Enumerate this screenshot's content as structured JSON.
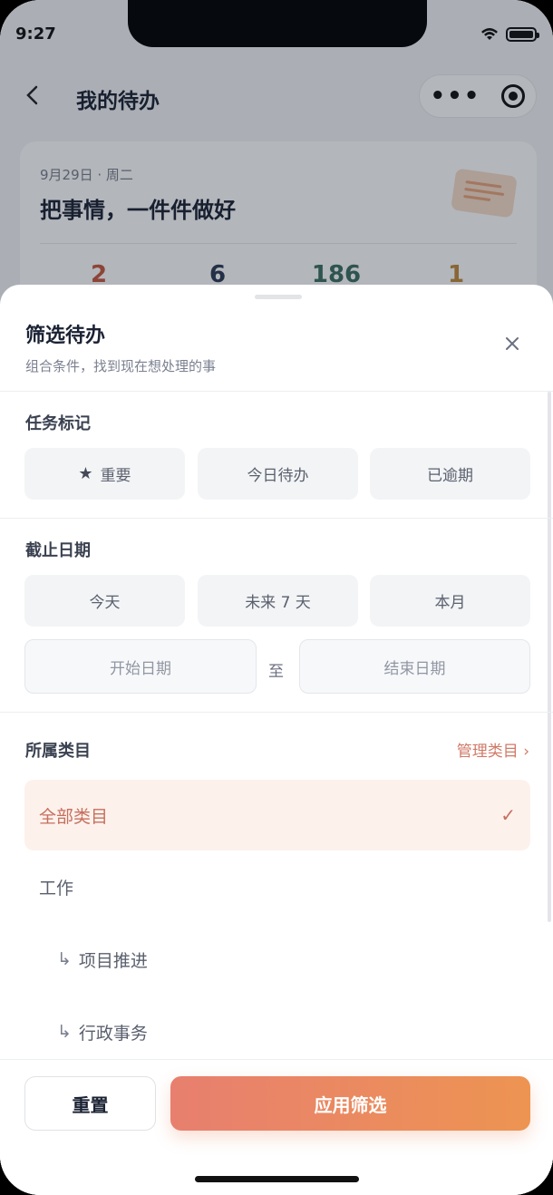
{
  "status": {
    "time": "9:27"
  },
  "nav": {
    "title": "我的待办"
  },
  "card": {
    "date": "9月29日 · 周二",
    "title": "把事情，一件件做好",
    "stats": [
      {
        "value": "2",
        "color": "#c8573f"
      },
      {
        "value": "6",
        "color": "#2c3a55"
      },
      {
        "value": "186",
        "color": "#3d6f60"
      },
      {
        "value": "1",
        "color": "#c08a3b"
      }
    ]
  },
  "sheet": {
    "title": "筛选待办",
    "subtitle": "组合条件，找到现在想处理的事",
    "tags_label": "任务标记",
    "tags": [
      "重要",
      "今日待办",
      "已逾期"
    ],
    "due_label": "截止日期",
    "due_options": [
      "今天",
      "未来 7 天",
      "本月"
    ],
    "start_placeholder": "开始日期",
    "to_label": "至",
    "end_placeholder": "结束日期",
    "category_label": "所属类目",
    "manage_label": "管理类目 ›",
    "categories": [
      {
        "label": "全部类目",
        "selected": true
      },
      {
        "label": "工作"
      },
      {
        "label": "项目推进",
        "child": true
      },
      {
        "label": "行政事务",
        "child": true
      }
    ],
    "check_mark": "✓",
    "child_arrow": "↳",
    "reset_label": "重置",
    "apply_label": "应用筛选"
  }
}
